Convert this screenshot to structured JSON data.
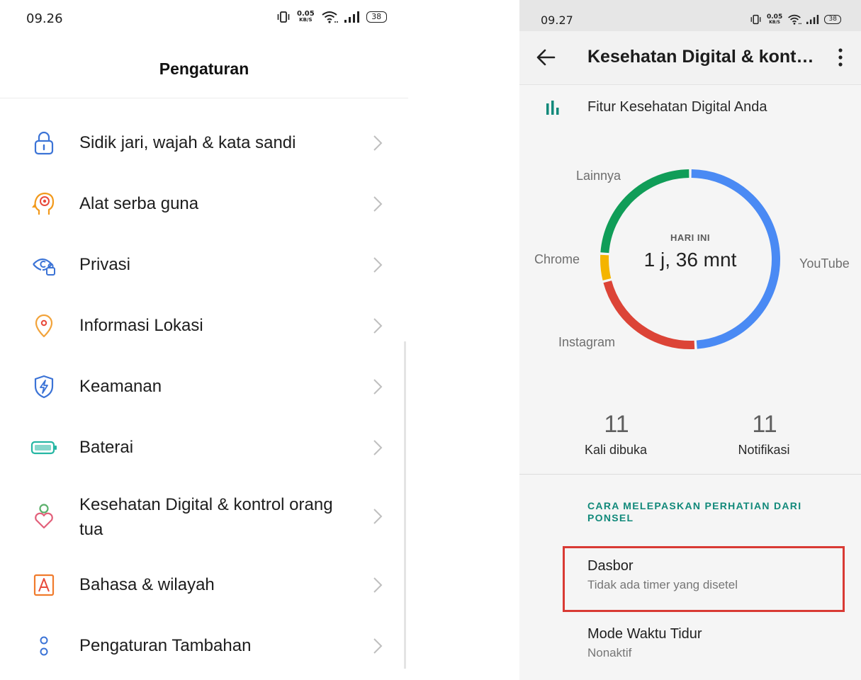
{
  "left_screen": {
    "status_bar": {
      "time": "09.26",
      "net_speed": "0.05",
      "net_unit": "KB/S",
      "battery": "38"
    },
    "title": "Pengaturan",
    "items": [
      {
        "label": "Sidik jari, wajah & kata sandi",
        "icon": "lock-icon",
        "color": "#3b73d6"
      },
      {
        "label": "Alat serba guna",
        "icon": "head-target-icon",
        "color": "#f29a1d"
      },
      {
        "label": "Privasi",
        "icon": "eye-lock-icon",
        "color": "#3b73d6"
      },
      {
        "label": "Informasi Lokasi",
        "icon": "location-pin-icon",
        "color": "#f2a33a"
      },
      {
        "label": "Keamanan",
        "icon": "shield-bolt-icon",
        "color": "#3b73d6"
      },
      {
        "label": "Baterai",
        "icon": "battery-icon",
        "color": "#25b6a3"
      },
      {
        "label": "Kesehatan Digital & kontrol orang tua",
        "icon": "person-heart-icon",
        "color": "#5bb06b"
      },
      {
        "label": "Bahasa & wilayah",
        "icon": "language-a-icon",
        "color": "#f07b2c"
      },
      {
        "label": "Pengaturan Tambahan",
        "icon": "two-dots-icon",
        "color": "#3b73d6"
      }
    ]
  },
  "right_screen": {
    "status_bar": {
      "time": "09.27",
      "net_speed": "0.05",
      "net_unit": "KB/S",
      "battery": "38"
    },
    "app_bar": {
      "title": "Kesehatan Digital & kont…"
    },
    "feature_label": "Fitur Kesehatan Digital Anda",
    "donut": {
      "center_small": "HARI INI",
      "center_big": "1 j, 36 mnt",
      "segments": [
        {
          "label": "YouTube",
          "fraction": 0.49,
          "color": "#4a8af4"
        },
        {
          "label": "Instagram",
          "fraction": 0.22,
          "color": "#dc4437"
        },
        {
          "label": "Chrome",
          "fraction": 0.05,
          "color": "#f4b400"
        },
        {
          "label": "Lainnya",
          "fraction": 0.24,
          "color": "#109d58"
        }
      ]
    },
    "stats": [
      {
        "value": "11",
        "label": "Kali dibuka"
      },
      {
        "value": "11",
        "label": "Notifikasi"
      }
    ],
    "section_header": "CARA MELEPASKAN PERHATIAN DARI PONSEL",
    "rows": [
      {
        "title": "Dasbor",
        "subtitle": "Tidak ada timer yang disetel"
      },
      {
        "title": "Mode Waktu Tidur",
        "subtitle": "Nonaktif"
      }
    ],
    "highlight_color": "#d93a34"
  }
}
